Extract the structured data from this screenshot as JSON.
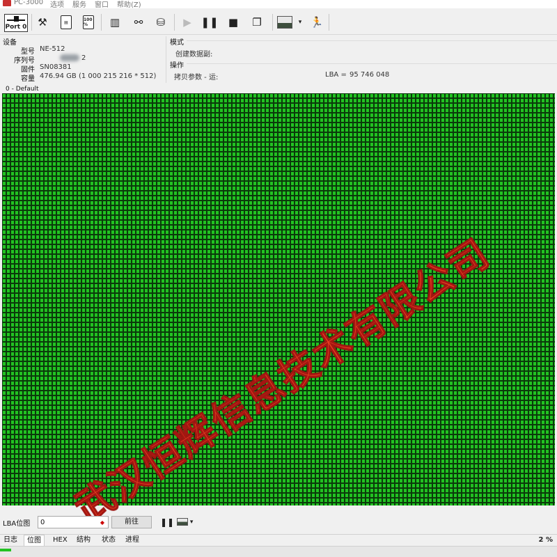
{
  "menubar": {
    "app_title": "PC-3000",
    "items": [
      "选项",
      "服务",
      "窗口",
      "帮助(Z)"
    ]
  },
  "toolbar": {
    "port_label": "Port 0",
    "icons": [
      "port0-icon",
      "tools-icon",
      "sd-card-icon",
      "percent-doc-icon",
      "disk-info-icon",
      "binoculars-icon",
      "disk-export-icon",
      "play-icon",
      "pause-icon",
      "stop-icon",
      "copy-windows-icon",
      "map-view-icon",
      "dropdown-icon",
      "running-man-icon"
    ],
    "percent_doc_label": "100 %"
  },
  "device": {
    "group_label": "设备",
    "model_label": "型号",
    "model_value": "NE-512",
    "serial_label": "序列号",
    "serial_visible_suffix": "2",
    "firmware_label": "固件",
    "firmware_value": "SN08381",
    "capacity_label": "容量",
    "capacity_value": "476.94 GB (1 000 215 216 * 512)"
  },
  "mode": {
    "group_label": "模式",
    "value": "创建数据副:"
  },
  "operation": {
    "group_label": "操作",
    "value": "拷贝参数 - 运:",
    "lba_label": "LBA =",
    "lba_value": "95 746 048"
  },
  "map": {
    "title": "0 - Default",
    "cell_color": "#22c222",
    "cell_border_color": "#0b3a0b",
    "state": "all-read-ok"
  },
  "watermark": {
    "text": "武汉恒辉信息技术有限公司",
    "color": "#e84020"
  },
  "lba_nav": {
    "label": "LBA位图",
    "input_value": "0",
    "goto_label": "前往"
  },
  "tabs": [
    "日志",
    "位图",
    "HEX",
    "结构",
    "状态",
    "进程"
  ],
  "active_tab": "位图",
  "progress": {
    "percent_label": "2 %",
    "fraction": 0.02,
    "color": "#22c222"
  }
}
